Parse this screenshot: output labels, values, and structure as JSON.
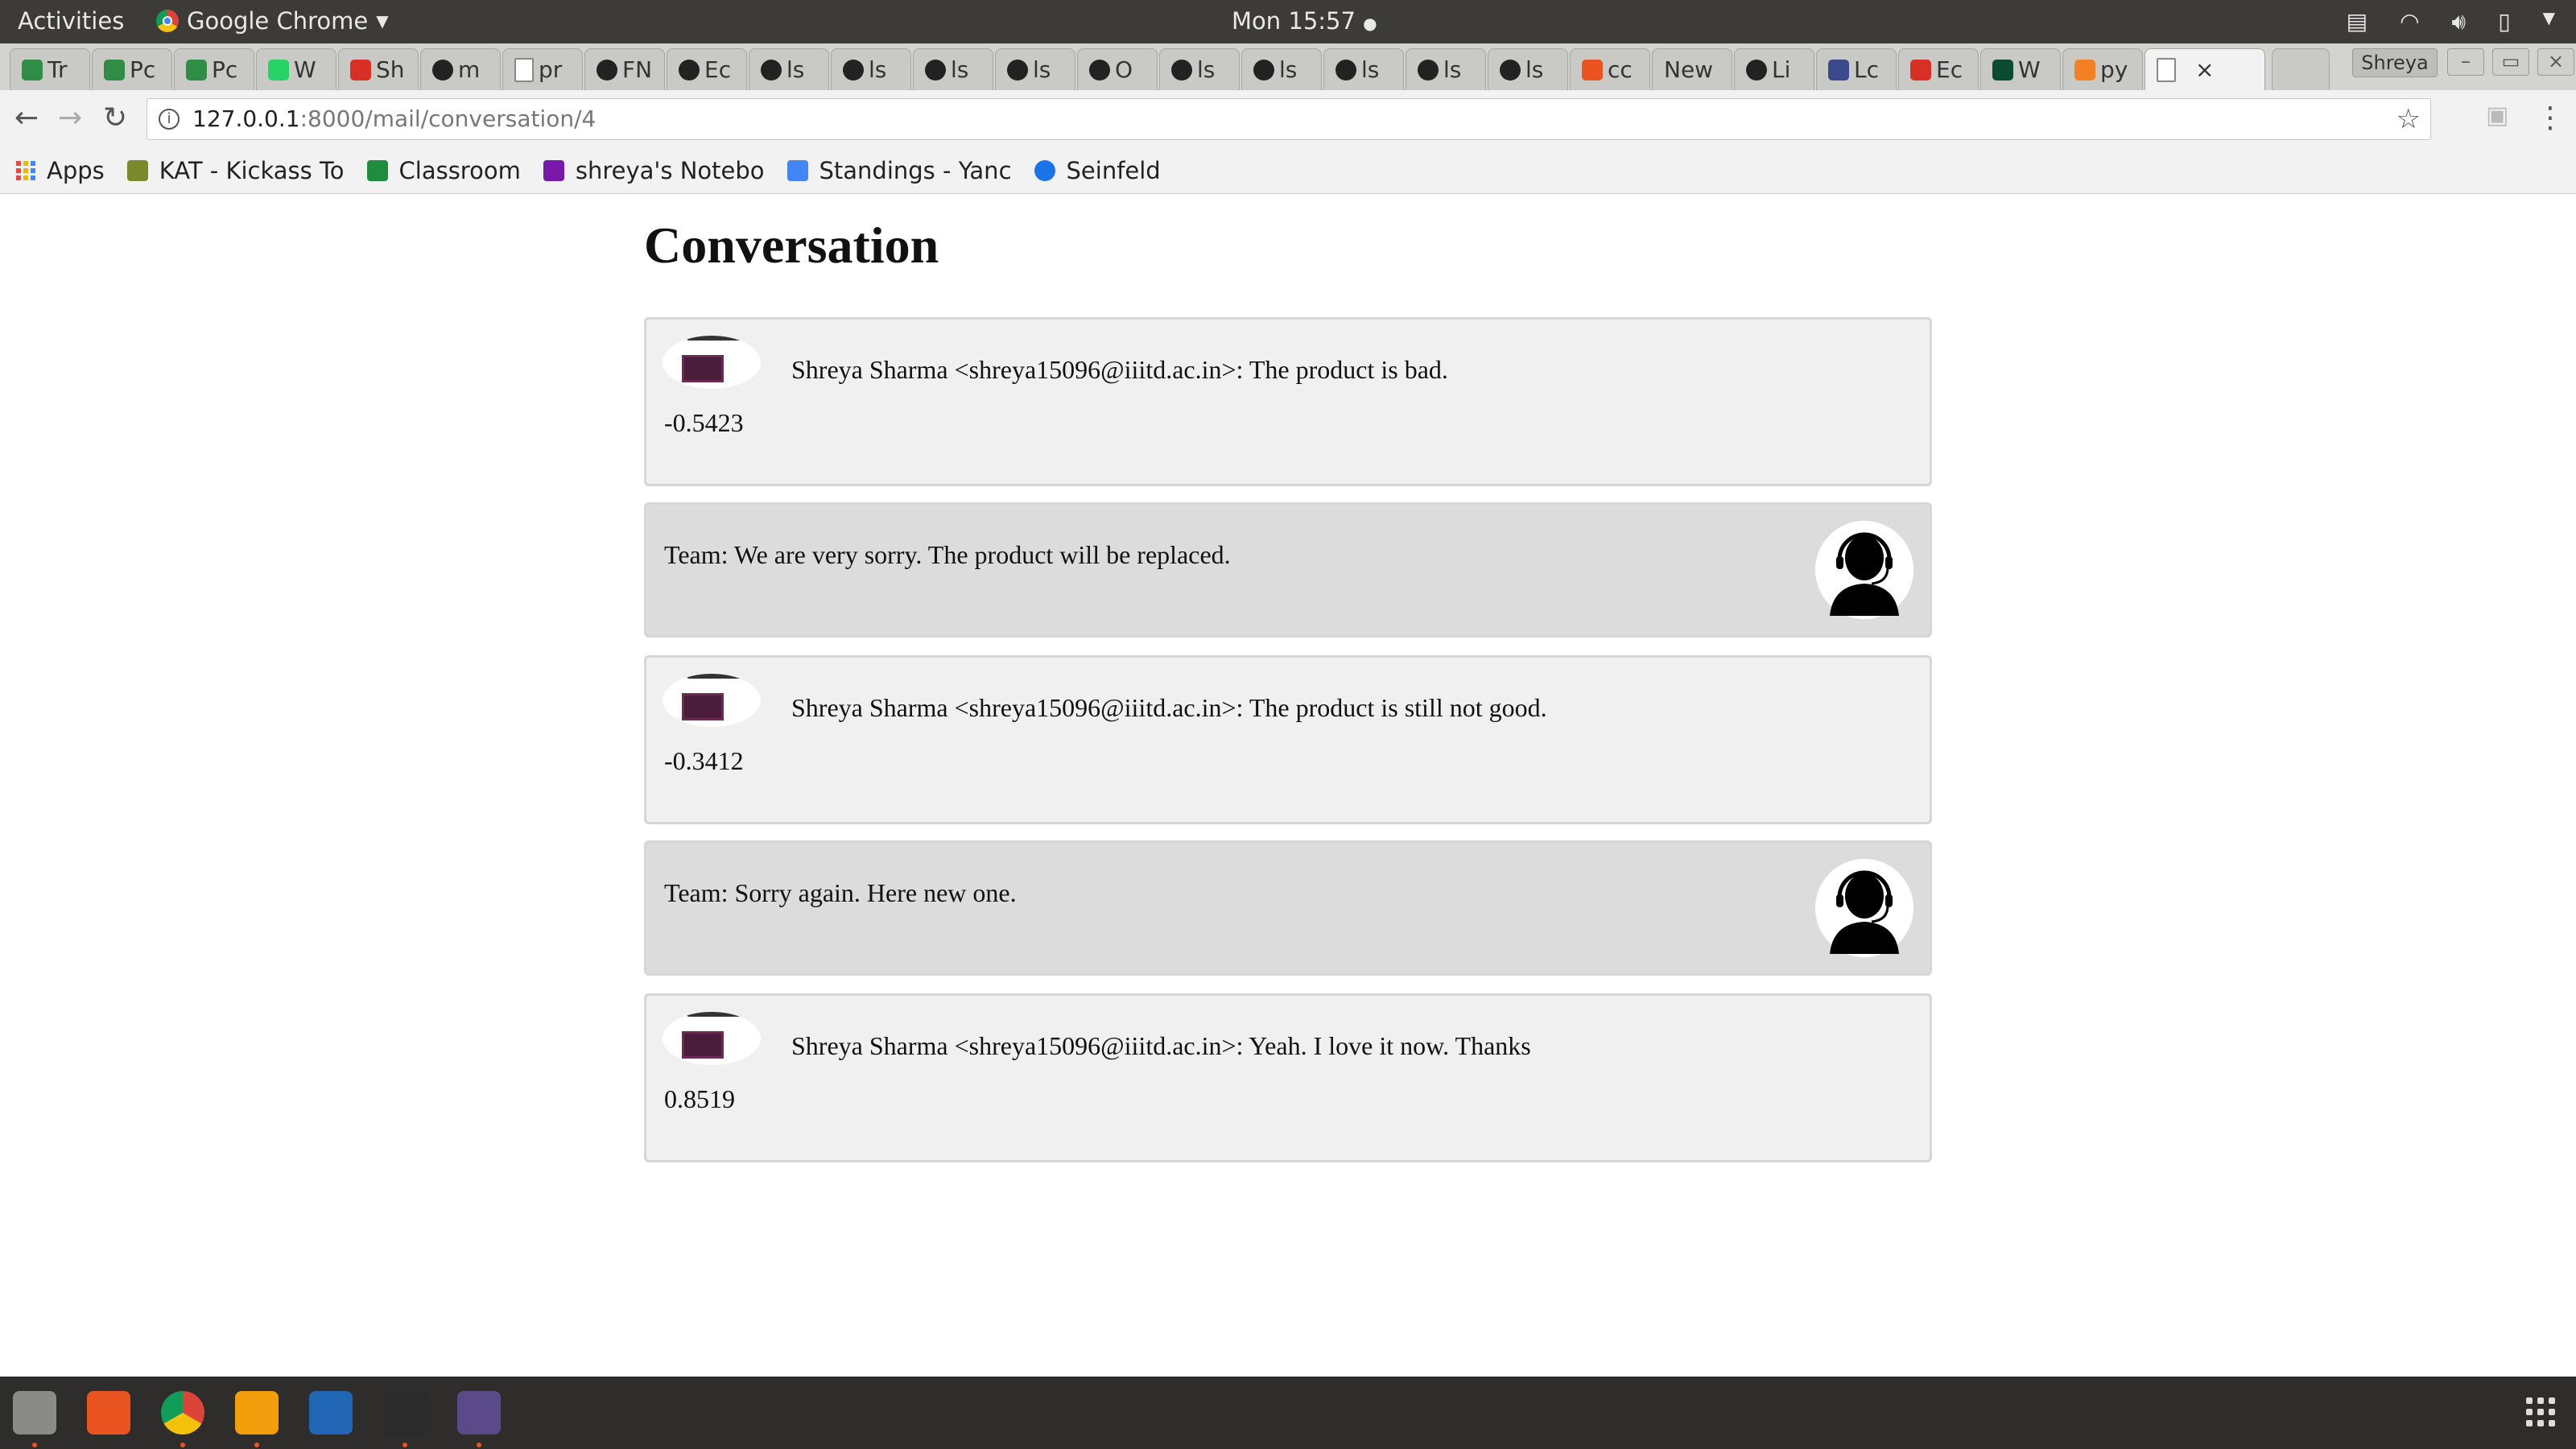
{
  "system_bar": {
    "activities": "Activities",
    "app_name": "Google Chrome",
    "clock": "Mon 15:57",
    "user": "Shreya"
  },
  "tabs": [
    {
      "label": "Tr",
      "icon": "gfg-icon",
      "color": "#2f8d46"
    },
    {
      "label": "Pc",
      "icon": "gfg-icon",
      "color": "#2f8d46"
    },
    {
      "label": "Pc",
      "icon": "gfg-icon",
      "color": "#2f8d46"
    },
    {
      "label": "W",
      "icon": "whatsapp-icon",
      "color": "#25d366"
    },
    {
      "label": "Sh",
      "icon": "gmail-icon",
      "color": "#d93025"
    },
    {
      "label": "m",
      "icon": "github-icon",
      "color": "#222222"
    },
    {
      "label": "pr",
      "icon": "page-icon",
      "color": "#888888"
    },
    {
      "label": "FN",
      "icon": "github-icon",
      "color": "#222222"
    },
    {
      "label": "Ec",
      "icon": "github-icon",
      "color": "#222222"
    },
    {
      "label": "ls",
      "icon": "github-icon",
      "color": "#222222"
    },
    {
      "label": "ls",
      "icon": "github-icon",
      "color": "#222222"
    },
    {
      "label": "ls",
      "icon": "github-icon",
      "color": "#222222"
    },
    {
      "label": "ls",
      "icon": "github-icon",
      "color": "#222222"
    },
    {
      "label": "O",
      "icon": "github-icon",
      "color": "#222222"
    },
    {
      "label": "ls",
      "icon": "github-icon",
      "color": "#222222"
    },
    {
      "label": "ls",
      "icon": "github-icon",
      "color": "#222222"
    },
    {
      "label": "ls",
      "icon": "github-icon",
      "color": "#222222"
    },
    {
      "label": "ls",
      "icon": "github-icon",
      "color": "#222222"
    },
    {
      "label": "ls",
      "icon": "github-icon",
      "color": "#222222"
    },
    {
      "label": "cc",
      "icon": "askubuntu-icon",
      "color": "#e95420"
    },
    {
      "label": "New",
      "icon": "",
      "color": ""
    },
    {
      "label": "Li",
      "icon": "github-icon",
      "color": "#222222"
    },
    {
      "label": "Lc",
      "icon": "globe-icon",
      "color": "#3b4a8c"
    },
    {
      "label": "Ec",
      "icon": "gmail-icon",
      "color": "#d93025"
    },
    {
      "label": "W",
      "icon": "django-icon",
      "color": "#0c4b33"
    },
    {
      "label": "py",
      "icon": "stackoverflow-icon",
      "color": "#f48024"
    },
    {
      "label": "",
      "icon": "page-icon",
      "color": "#888888",
      "active": true
    }
  ],
  "address_bar": {
    "url_host": "127.0.0.1",
    "url_path": ":8000/mail/conversation/4"
  },
  "bookmarks": [
    {
      "label": "Apps",
      "icon": "apps-grid-icon",
      "color": ""
    },
    {
      "label": "KAT - Kickass To",
      "icon": "kat-shield-icon",
      "color": "#7a8a2a"
    },
    {
      "label": "Classroom",
      "icon": "classroom-icon",
      "color": "#1e8e3e"
    },
    {
      "label": "shreya's Notebo",
      "icon": "onenote-icon",
      "color": "#7719aa"
    },
    {
      "label": "Standings - Yanc",
      "icon": "bar-chart-icon",
      "color": "#4285f4"
    },
    {
      "label": "Seinfeld",
      "icon": "play-circle-icon",
      "color": "#1a73e8"
    }
  ],
  "page": {
    "title": "Conversation",
    "messages": [
      {
        "type": "customer",
        "text": "Shreya Sharma <shreya15096@iiitd.ac.in>: The product is bad.",
        "score": "-0.5423"
      },
      {
        "type": "team",
        "text": "Team: We are very sorry. The product will be replaced."
      },
      {
        "type": "customer",
        "text": "Shreya Sharma <shreya15096@iiitd.ac.in>: The product is still not good.",
        "score": "-0.3412"
      },
      {
        "type": "team",
        "text": "Team: Sorry again. Here new one."
      },
      {
        "type": "customer",
        "text": "Shreya Sharma <shreya15096@iiitd.ac.in>: Yeah. I love it now. Thanks",
        "score": "0.8519"
      }
    ]
  },
  "dock": [
    {
      "name": "files-icon",
      "color": "#8a8a86",
      "running": true
    },
    {
      "name": "software-center-icon",
      "color": "#e95420",
      "running": false
    },
    {
      "name": "chrome-icon",
      "color": "#4285f4",
      "running": true
    },
    {
      "name": "sublime-text-icon",
      "color": "#f29d0c",
      "running": true
    },
    {
      "name": "r-studio-icon",
      "color": "#2166b5",
      "running": false
    },
    {
      "name": "terminal-icon",
      "color": "#2b2b2b",
      "running": true
    },
    {
      "name": "settings-icon",
      "color": "#5a4a8a",
      "running": true
    }
  ]
}
